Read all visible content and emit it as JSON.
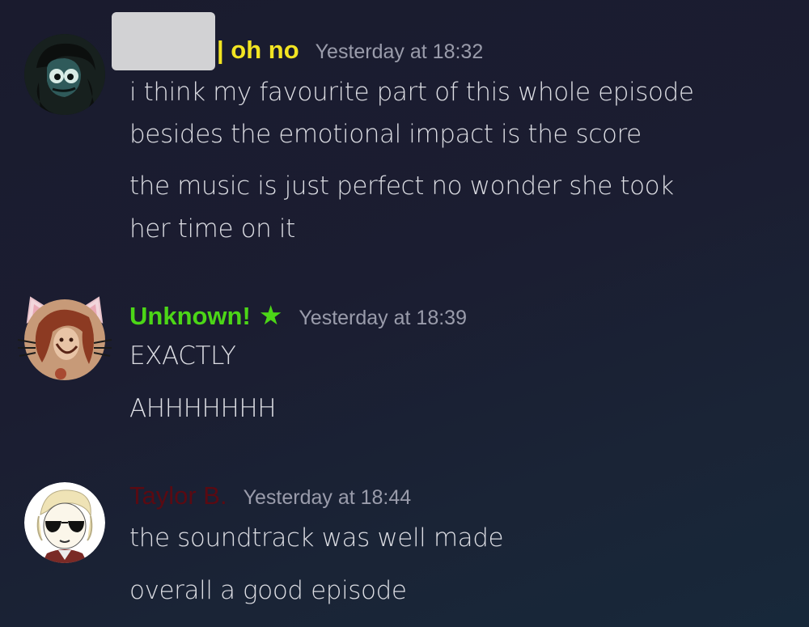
{
  "messages": [
    {
      "username": "| oh no",
      "username_color": "#f2e422",
      "timestamp": "Yesterday at 18:32",
      "lines": [
        "i think my favourite part of this whole episode",
        "besides the emotional impact is the score",
        "the music is just perfect no wonder she took",
        "her time on it"
      ]
    },
    {
      "username": "Unknown!",
      "username_color": "#4cd617",
      "badge_icon": "star-icon",
      "timestamp": "Yesterday at 18:39",
      "lines": [
        "EXACTLY",
        "AHHHHHHH"
      ]
    },
    {
      "username": "Taylor B.",
      "username_color": "#5a0a12",
      "timestamp": "Yesterday at 18:44",
      "lines": [
        "the soundtrack was well made",
        "overall a good episode"
      ]
    }
  ],
  "star_glyph": "★"
}
